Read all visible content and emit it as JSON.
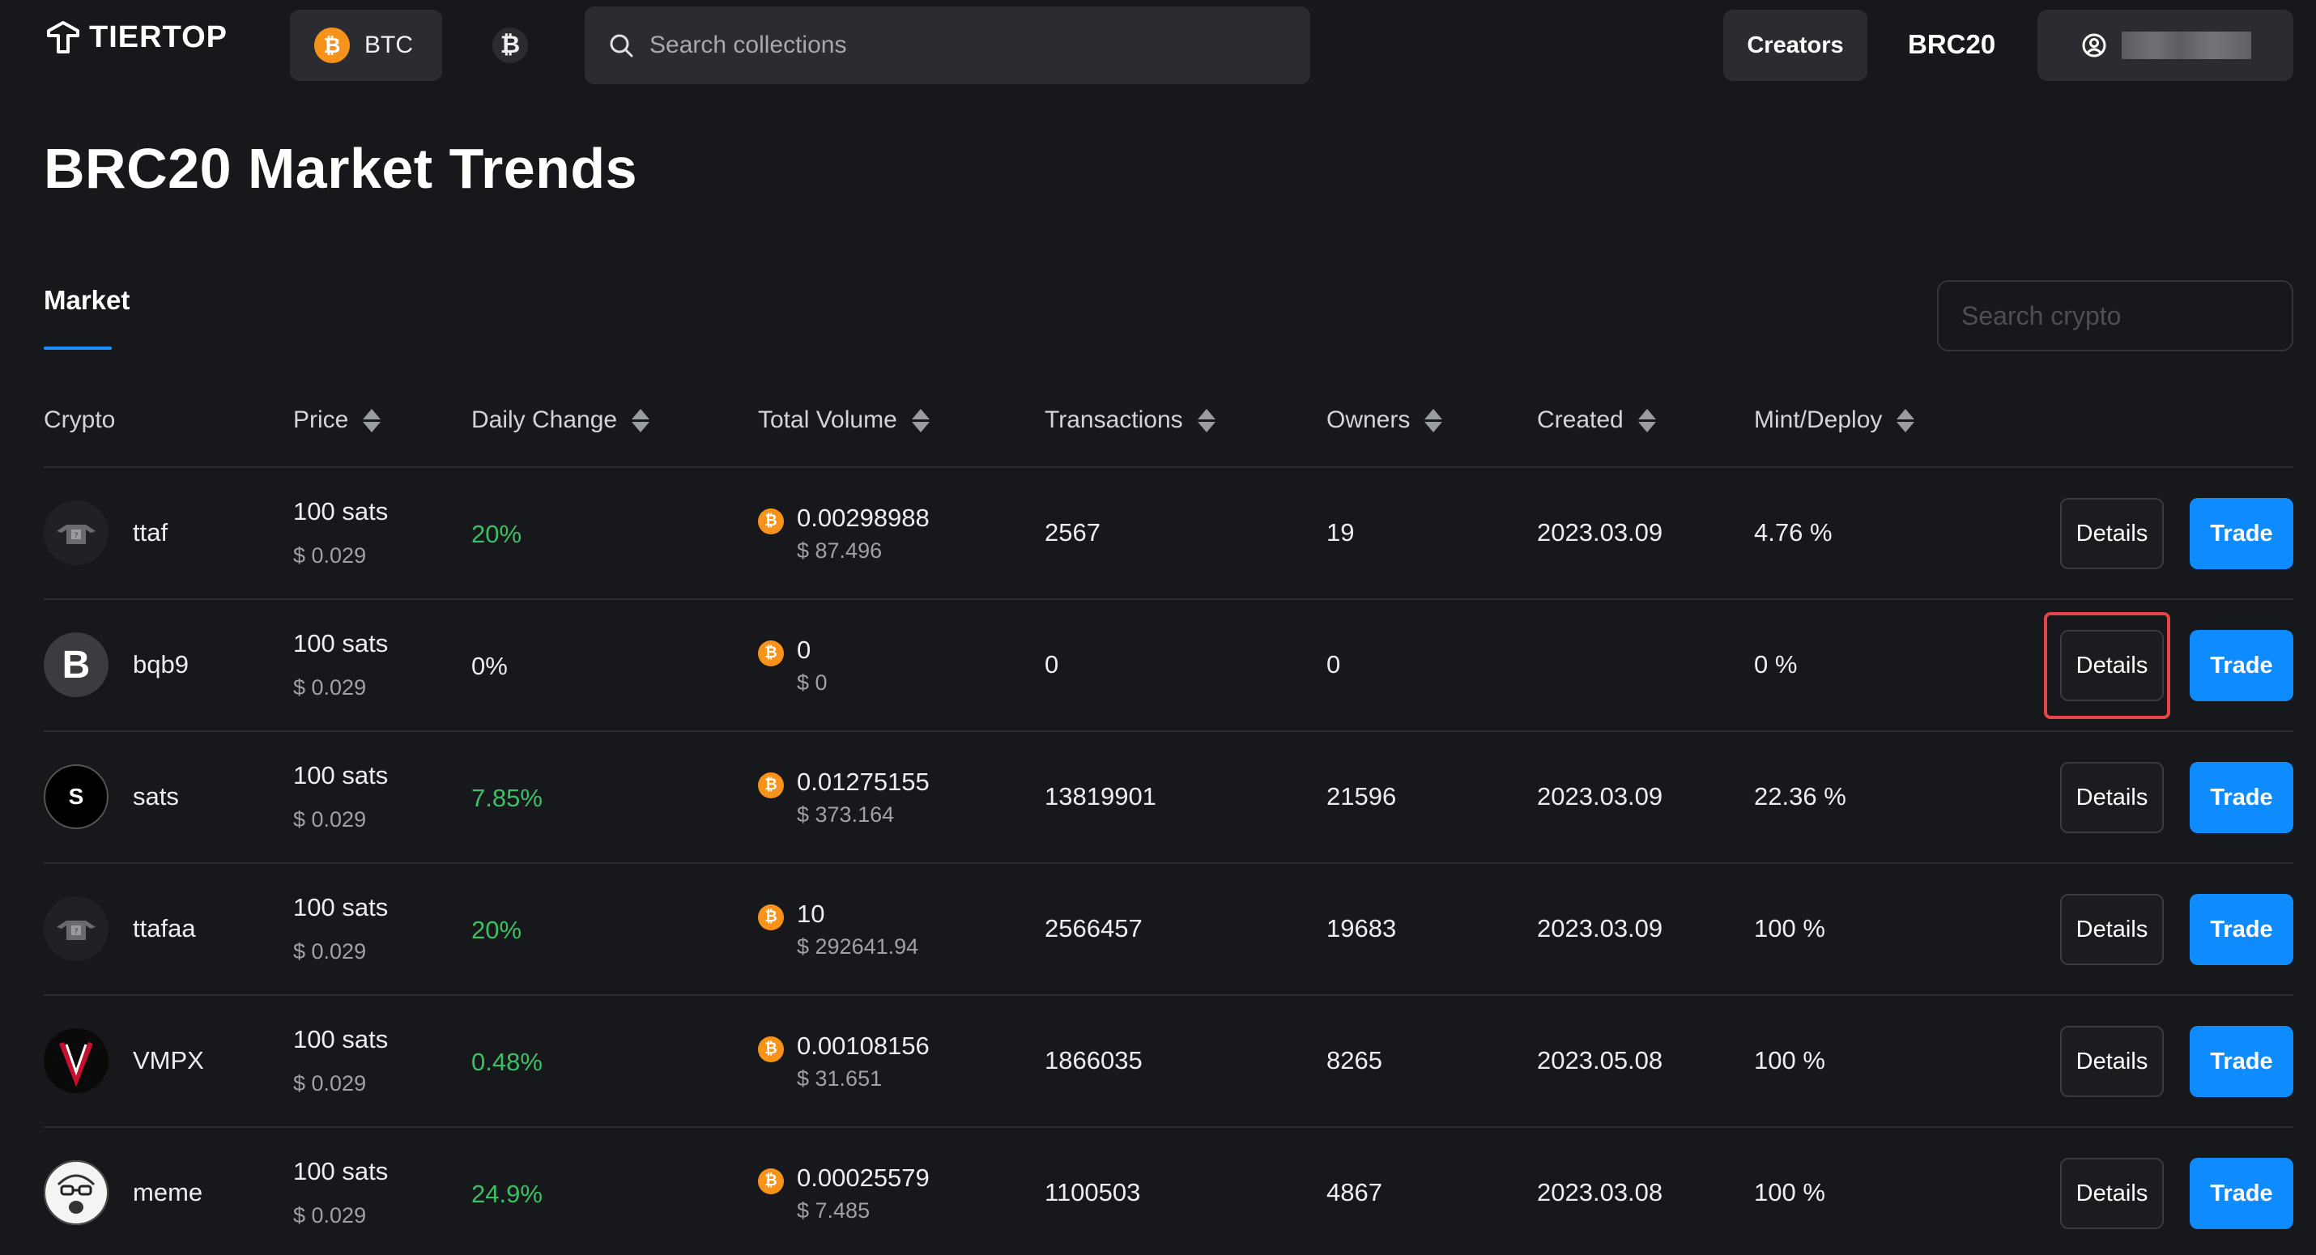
{
  "header": {
    "logo_text": "TIERTOP",
    "chain_label": "BTC",
    "search_placeholder": "Search collections",
    "creators_label": "Creators",
    "brc20_label": "BRC20"
  },
  "page": {
    "title": "BRC20 Market Trends",
    "tab_market": "Market",
    "crypto_search_placeholder": "Search crypto"
  },
  "columns": [
    "Crypto",
    "Price",
    "Daily Change",
    "Total Volume",
    "Transactions",
    "Owners",
    "Created",
    "Mint/Deploy"
  ],
  "actions": {
    "details": "Details",
    "trade": "Trade"
  },
  "rows": [
    {
      "name": "ttaf",
      "price": "100 sats",
      "price_usd": "$ 0.029",
      "change": "20%",
      "change_color": "#3cbf63",
      "volume": "0.00298988",
      "volume_usd": "$ 87.496",
      "transactions": "2567",
      "owners": "19",
      "created": "2023.03.09",
      "mint": "4.76 %",
      "avatar": "ghost-robot-icon"
    },
    {
      "name": "bqb9",
      "price": "100 sats",
      "price_usd": "$ 0.029",
      "change": "0%",
      "change_color": "#eceef2",
      "volume": "0",
      "volume_usd": "$ 0",
      "transactions": "0",
      "owners": "0",
      "created": "",
      "mint": "0 %",
      "avatar": "letter-b-icon",
      "avatar_text": "B",
      "highlighted": true
    },
    {
      "name": "sats",
      "price": "100 sats",
      "price_usd": "$ 0.029",
      "change": "7.85%",
      "change_color": "#3cbf63",
      "volume": "0.01275155",
      "volume_usd": "$ 373.164",
      "transactions": "13819901",
      "owners": "21596",
      "created": "2023.03.09",
      "mint": "22.36 %",
      "avatar": "letter-s-icon",
      "avatar_text": "S"
    },
    {
      "name": "ttafaa",
      "price": "100 sats",
      "price_usd": "$ 0.029",
      "change": "20%",
      "change_color": "#3cbf63",
      "volume": "10",
      "volume_usd": "$ 292641.94",
      "transactions": "2566457",
      "owners": "19683",
      "created": "2023.03.09",
      "mint": "100 %",
      "avatar": "ghost-robot-icon"
    },
    {
      "name": "VMPX",
      "price": "100 sats",
      "price_usd": "$ 0.029",
      "change": "0.48%",
      "change_color": "#3cbf63",
      "volume": "0.00108156",
      "volume_usd": "$ 31.651",
      "transactions": "1866035",
      "owners": "8265",
      "created": "2023.05.08",
      "mint": "100 %",
      "avatar": "vmpx-logo-icon"
    },
    {
      "name": "meme",
      "price": "100 sats",
      "price_usd": "$ 0.029",
      "change": "24.9%",
      "change_color": "#3cbf63",
      "volume": "0.00025579",
      "volume_usd": "$ 7.485",
      "transactions": "1100503",
      "owners": "4867",
      "created": "2023.03.08",
      "mint": "100 %",
      "avatar": "meme-face-icon"
    }
  ],
  "colors": {
    "accent": "#0e8bff",
    "positive": "#3cbf63",
    "bitcoin": "#f7931a",
    "highlight": "#e5454a"
  }
}
